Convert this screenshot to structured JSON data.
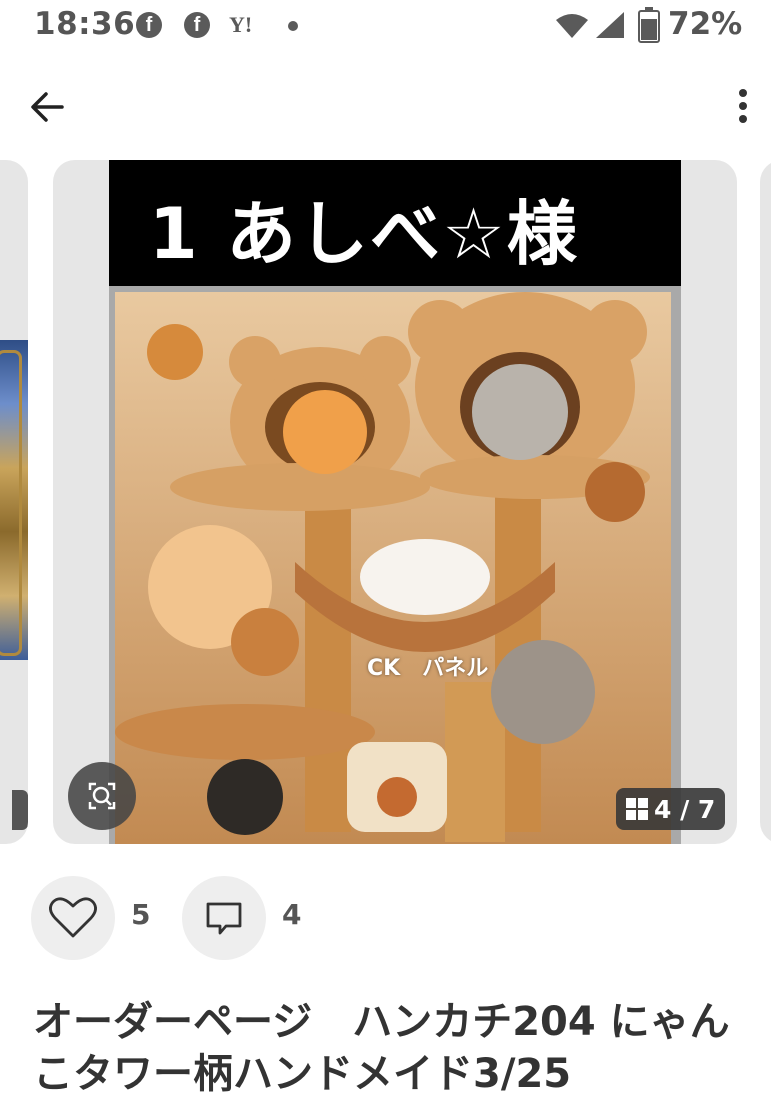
{
  "status_bar": {
    "time": "18:36",
    "yahoo_label": "Y!",
    "battery_percent": "72%",
    "notification_icons": [
      "facebook-icon",
      "facebook-icon",
      "yahoo-icon",
      "dot-icon"
    ],
    "system_icons": [
      "wifi-icon",
      "signal-icon",
      "battery-icon"
    ]
  },
  "app_bar": {
    "back_icon": "arrow-left-icon",
    "menu_icon": "more-vertical-icon"
  },
  "listing_image": {
    "banner_text": "1 あしべ☆様",
    "watermark": "CK　パネル",
    "counter": "4 / 7",
    "current": 4,
    "total": 7,
    "zoom_icon": "zoom-search-icon"
  },
  "actions": {
    "like_count": "5",
    "comment_count": "4"
  },
  "item": {
    "title": "オーダーページ　ハンカチ204 にゃんこタワー柄ハンドメイド3/25"
  },
  "colors": {
    "card_bg": "#e6e6e6",
    "action_bg": "#eeeeee",
    "counter_bg": "#373737"
  }
}
